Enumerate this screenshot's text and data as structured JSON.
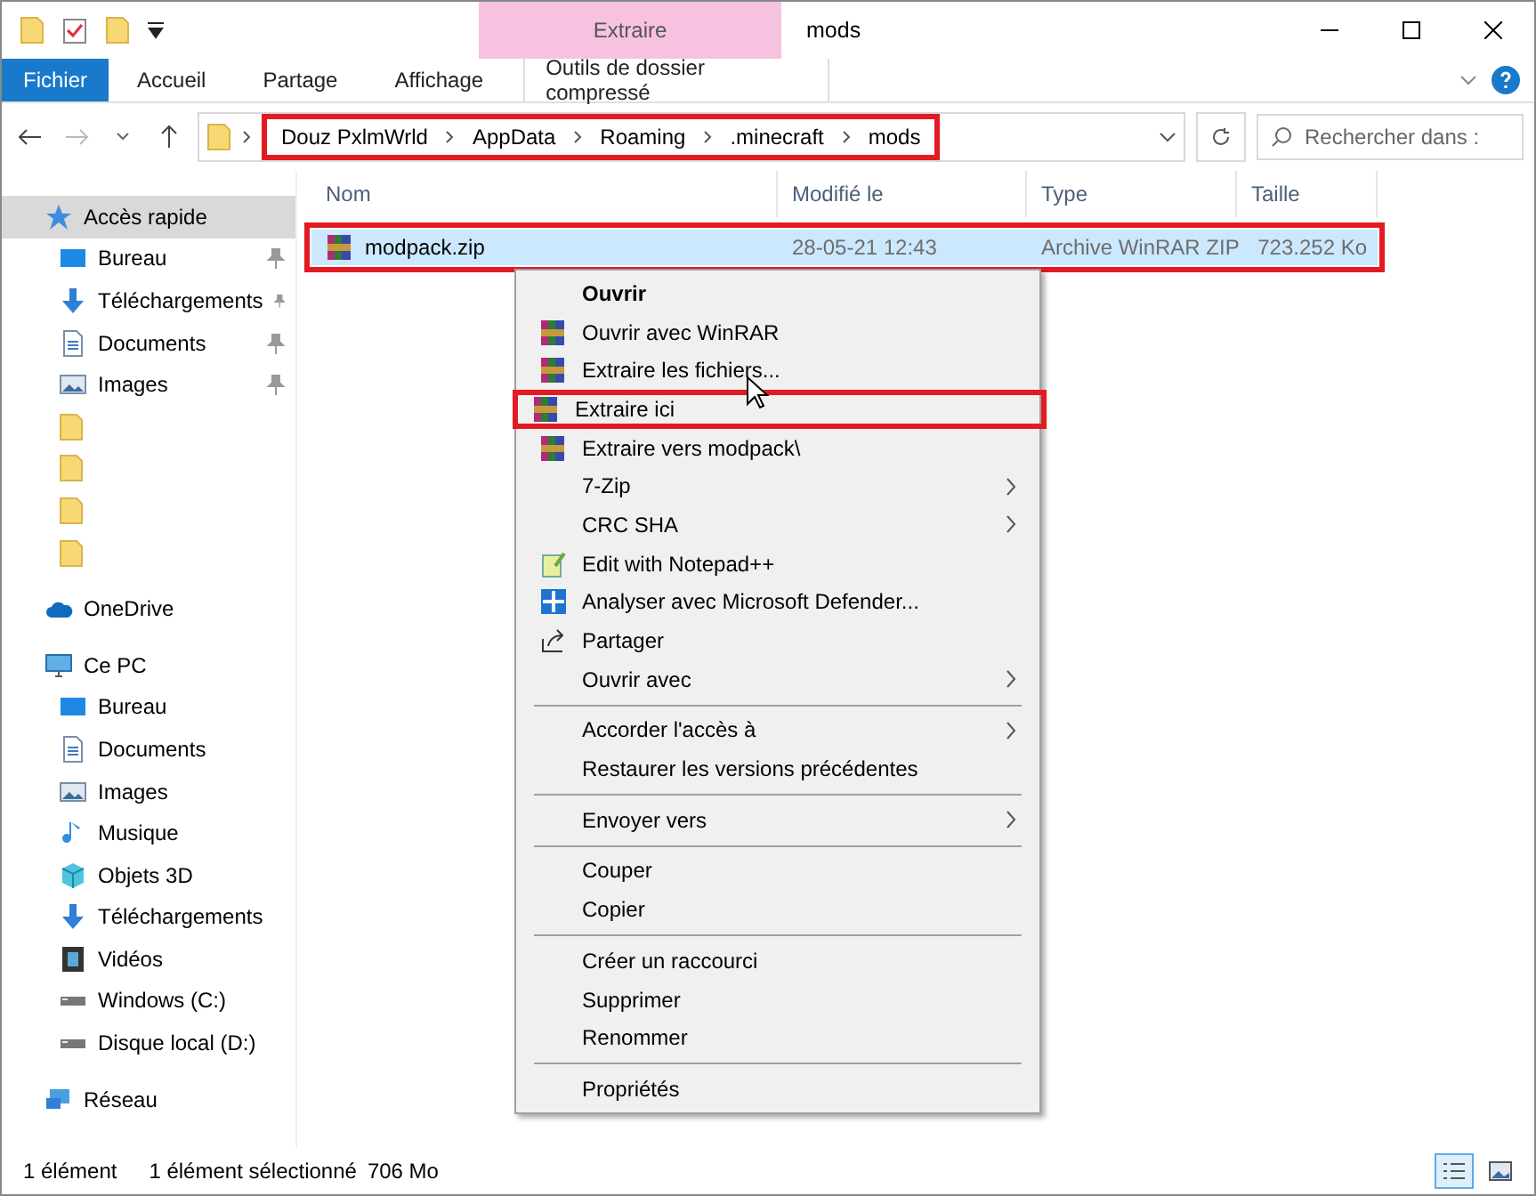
{
  "window": {
    "title": "mods",
    "context_group": "Extraire"
  },
  "ribbon": {
    "tabs": [
      {
        "label": "Fichier",
        "kind": "file"
      },
      {
        "label": "Accueil",
        "kind": "normal"
      },
      {
        "label": "Partage",
        "kind": "normal"
      },
      {
        "label": "Affichage",
        "kind": "normal"
      },
      {
        "label": "Outils de dossier compressé",
        "kind": "context"
      }
    ]
  },
  "address_bar": {
    "crumbs": [
      "Douz PxlmWrld",
      "AppData",
      "Roaming",
      ".minecraft",
      "mods"
    ],
    "highlighted": true
  },
  "search": {
    "placeholder": "Rechercher dans :"
  },
  "sidebar": {
    "items": [
      {
        "label": "Accès rapide",
        "selected": true,
        "children": [
          {
            "label": "Bureau",
            "pinned": true
          },
          {
            "label": "Téléchargements",
            "pinned": true
          },
          {
            "label": "Documents",
            "pinned": true
          },
          {
            "label": "Images",
            "pinned": true
          },
          {
            "pinned": false
          },
          {
            "pinned": false
          },
          {
            "pinned": false
          },
          {
            "pinned": false
          }
        ]
      },
      {
        "label": "OneDrive",
        "selected": false
      },
      {
        "label": "Ce PC",
        "selected": false,
        "children": [
          {
            "label": "Bureau"
          },
          {
            "label": "Documents"
          },
          {
            "label": "Images"
          },
          {
            "label": "Musique"
          },
          {
            "label": "Objets 3D"
          },
          {
            "label": "Téléchargements"
          },
          {
            "label": "Vidéos"
          },
          {
            "label": "Windows (C:)"
          },
          {
            "label": "Disque local (D:)"
          }
        ]
      },
      {
        "label": "Réseau",
        "selected": false
      }
    ]
  },
  "file_list": {
    "columns": [
      "Nom",
      "Modifié le",
      "Type",
      "Taille"
    ],
    "rows": [
      {
        "name": "modpack.zip",
        "modified": "28-05-21 12:43",
        "type": "Archive WinRAR ZIP",
        "size": "723.252 Ko",
        "selected": true,
        "highlighted": true
      }
    ]
  },
  "context_menu": {
    "items": [
      {
        "kind": "item",
        "label": "Ouvrir",
        "default": true
      },
      {
        "kind": "item",
        "label": "Ouvrir avec WinRAR"
      },
      {
        "kind": "item",
        "label": "Extraire les fichiers..."
      },
      {
        "kind": "item",
        "label": "Extraire ici",
        "highlighted": true
      },
      {
        "kind": "item",
        "label": "Extraire vers modpack\\"
      },
      {
        "kind": "item",
        "label": "7-Zip",
        "submenu": true
      },
      {
        "kind": "item",
        "label": "CRC SHA",
        "submenu": true
      },
      {
        "kind": "item",
        "label": "Edit with Notepad++"
      },
      {
        "kind": "item",
        "label": "Analyser avec Microsoft Defender..."
      },
      {
        "kind": "item",
        "label": "Partager"
      },
      {
        "kind": "item",
        "label": "Ouvrir avec",
        "submenu": true
      },
      {
        "kind": "separator"
      },
      {
        "kind": "item",
        "label": "Accorder l'accès à",
        "submenu": true
      },
      {
        "kind": "item",
        "label": "Restaurer les versions précédentes"
      },
      {
        "kind": "separator"
      },
      {
        "kind": "item",
        "label": "Envoyer vers",
        "submenu": true
      },
      {
        "kind": "separator"
      },
      {
        "kind": "item",
        "label": "Couper"
      },
      {
        "kind": "item",
        "label": "Copier"
      },
      {
        "kind": "separator"
      },
      {
        "kind": "item",
        "label": "Créer un raccourci"
      },
      {
        "kind": "item",
        "label": "Supprimer"
      },
      {
        "kind": "item",
        "label": "Renommer"
      },
      {
        "kind": "separator"
      },
      {
        "kind": "item",
        "label": "Propriétés"
      }
    ]
  },
  "status_bar": {
    "item_count": "1 élément",
    "selection": "1 élément sélectionné",
    "size": "706 Mo",
    "views": [
      {
        "kind": "details",
        "selected": true
      },
      {
        "kind": "tiles",
        "selected": false
      }
    ]
  }
}
